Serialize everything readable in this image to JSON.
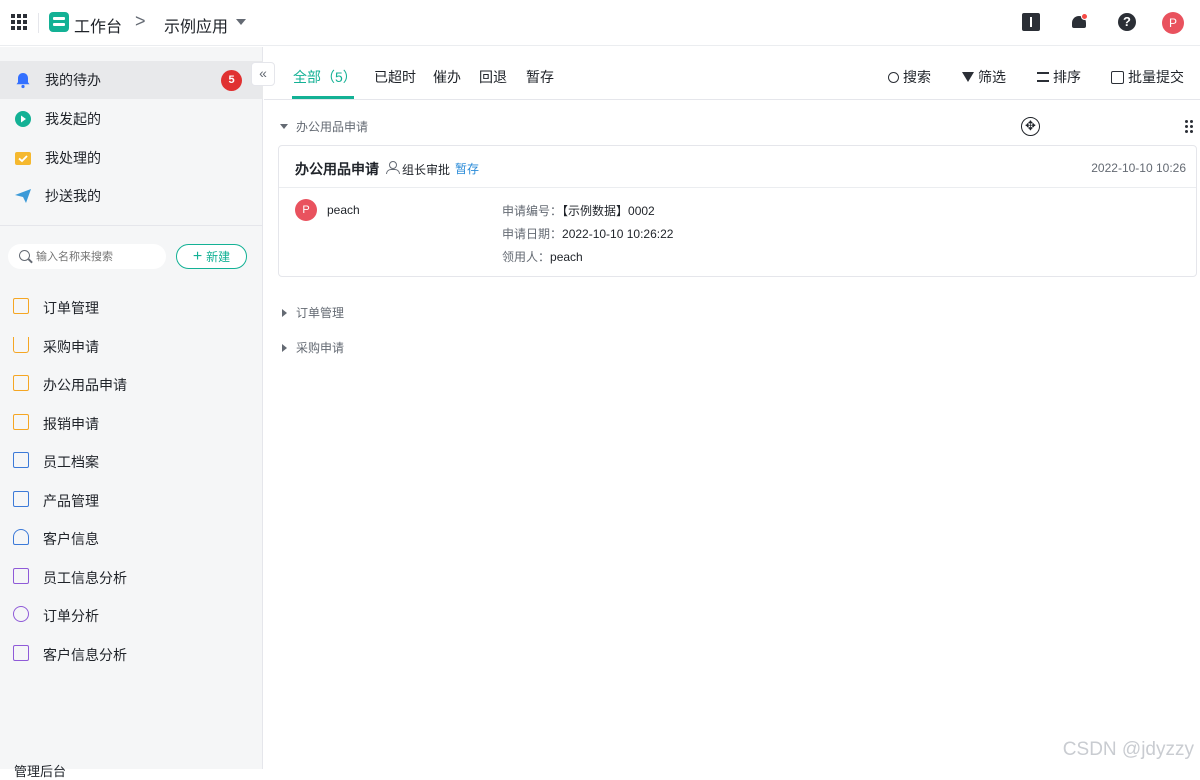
{
  "topbar": {
    "workspace_title": "工作台",
    "breadcrumb_separator": ">",
    "app_name": "示例应用",
    "avatar_letter": "P",
    "help_glyph": "?"
  },
  "sidebar": {
    "collapse_glyph": "«",
    "primary": [
      {
        "label": "我的待办",
        "icon": "bell-icon",
        "color": "#3370ff",
        "active": true
      },
      {
        "label": "我发起的",
        "icon": "play-icon",
        "color": "#13b195"
      },
      {
        "label": "我处理的",
        "icon": "check-box-icon",
        "color": "#f5b82e"
      },
      {
        "label": "抄送我的",
        "icon": "send-icon",
        "color": "#3c9ad8"
      }
    ],
    "pending_badge": "5",
    "search": {
      "placeholder": "输入名称来搜索"
    },
    "new_button": {
      "plus": "+",
      "label": "新建"
    },
    "forms": [
      {
        "label": "订单管理",
        "icon": "order-form-icon",
        "color": "#f5a623"
      },
      {
        "label": "采购申请",
        "icon": "cart-icon",
        "color": "#f5a623"
      },
      {
        "label": "办公用品申请",
        "icon": "mail-icon",
        "color": "#f5a623"
      },
      {
        "label": "报销申请",
        "icon": "receipt-icon",
        "color": "#f5a623"
      },
      {
        "label": "员工档案",
        "icon": "document-icon",
        "color": "#3c7ad8"
      },
      {
        "label": "产品管理",
        "icon": "store-icon",
        "color": "#3c7ad8"
      },
      {
        "label": "客户信息",
        "icon": "user-icon",
        "color": "#3c7ad8"
      },
      {
        "label": "员工信息分析",
        "icon": "bar-chart-icon",
        "color": "#8f5ad8"
      },
      {
        "label": "订单分析",
        "icon": "pie-chart-icon",
        "color": "#8f5ad8"
      },
      {
        "label": "客户信息分析",
        "icon": "monitor-chart-icon",
        "color": "#8f5ad8"
      }
    ],
    "admin_label": "管理后台"
  },
  "tabs": [
    {
      "label": "全部（5）",
      "active": true
    },
    {
      "label": "已超时"
    },
    {
      "label": "催办"
    },
    {
      "label": "回退"
    },
    {
      "label": "暂存"
    }
  ],
  "tools": {
    "search": "搜索",
    "filter": "筛选",
    "sort": "排序",
    "batch_submit": "批量提交"
  },
  "groups": {
    "expanded": "办公用品申请",
    "collapsed": [
      "订单管理",
      "采购申请"
    ]
  },
  "card": {
    "title": "办公用品申请",
    "node": "组长审批",
    "status": "暂存",
    "time": "2022-10-10 10:26",
    "user_initial": "P",
    "user_name": "peach",
    "fields": [
      {
        "key": "申请编号：",
        "value": "【示例数据】0002"
      },
      {
        "key": "申请日期：",
        "value": "2022-10-10 10:26:22"
      },
      {
        "key": "领用人：",
        "value": "peach"
      }
    ]
  },
  "move_glyph": "✥",
  "watermark": "CSDN @jdyzzy"
}
